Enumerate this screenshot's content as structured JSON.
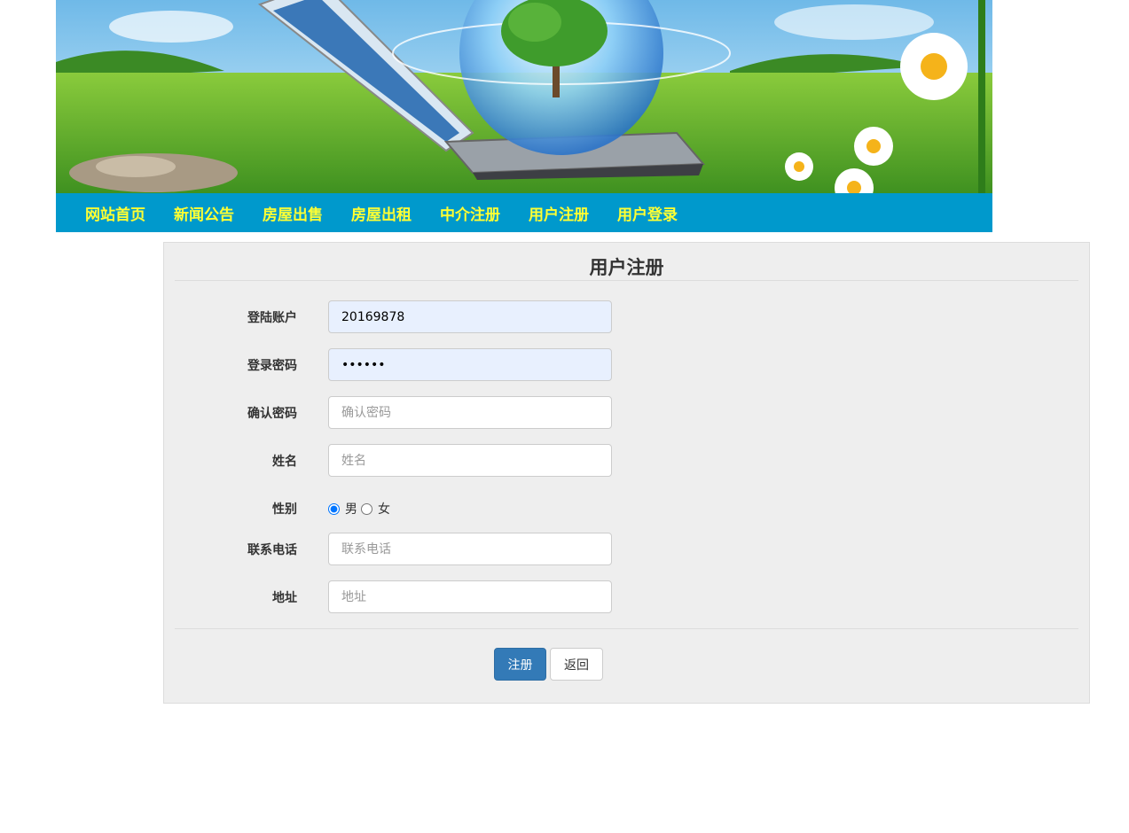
{
  "nav": {
    "items": [
      {
        "label": "网站首页"
      },
      {
        "label": "新闻公告"
      },
      {
        "label": "房屋出售"
      },
      {
        "label": "房屋出租"
      },
      {
        "label": "中介注册"
      },
      {
        "label": "用户注册"
      },
      {
        "label": "用户登录"
      }
    ]
  },
  "form": {
    "title": "用户注册",
    "account": {
      "label": "登陆账户",
      "value": "20169878"
    },
    "password": {
      "label": "登录密码",
      "value": "123456"
    },
    "confirm": {
      "label": "确认密码",
      "placeholder": "确认密码"
    },
    "name": {
      "label": "姓名",
      "placeholder": "姓名"
    },
    "gender": {
      "label": "性别",
      "options": [
        "男",
        "女"
      ],
      "selected": "男"
    },
    "phone": {
      "label": "联系电话",
      "placeholder": "联系电话"
    },
    "address": {
      "label": "地址",
      "placeholder": "地址"
    },
    "submit_label": "注册",
    "back_label": "返回"
  },
  "colors": {
    "nav_bg": "#0099cc",
    "nav_text": "#ffff33",
    "primary": "#337ab7"
  }
}
